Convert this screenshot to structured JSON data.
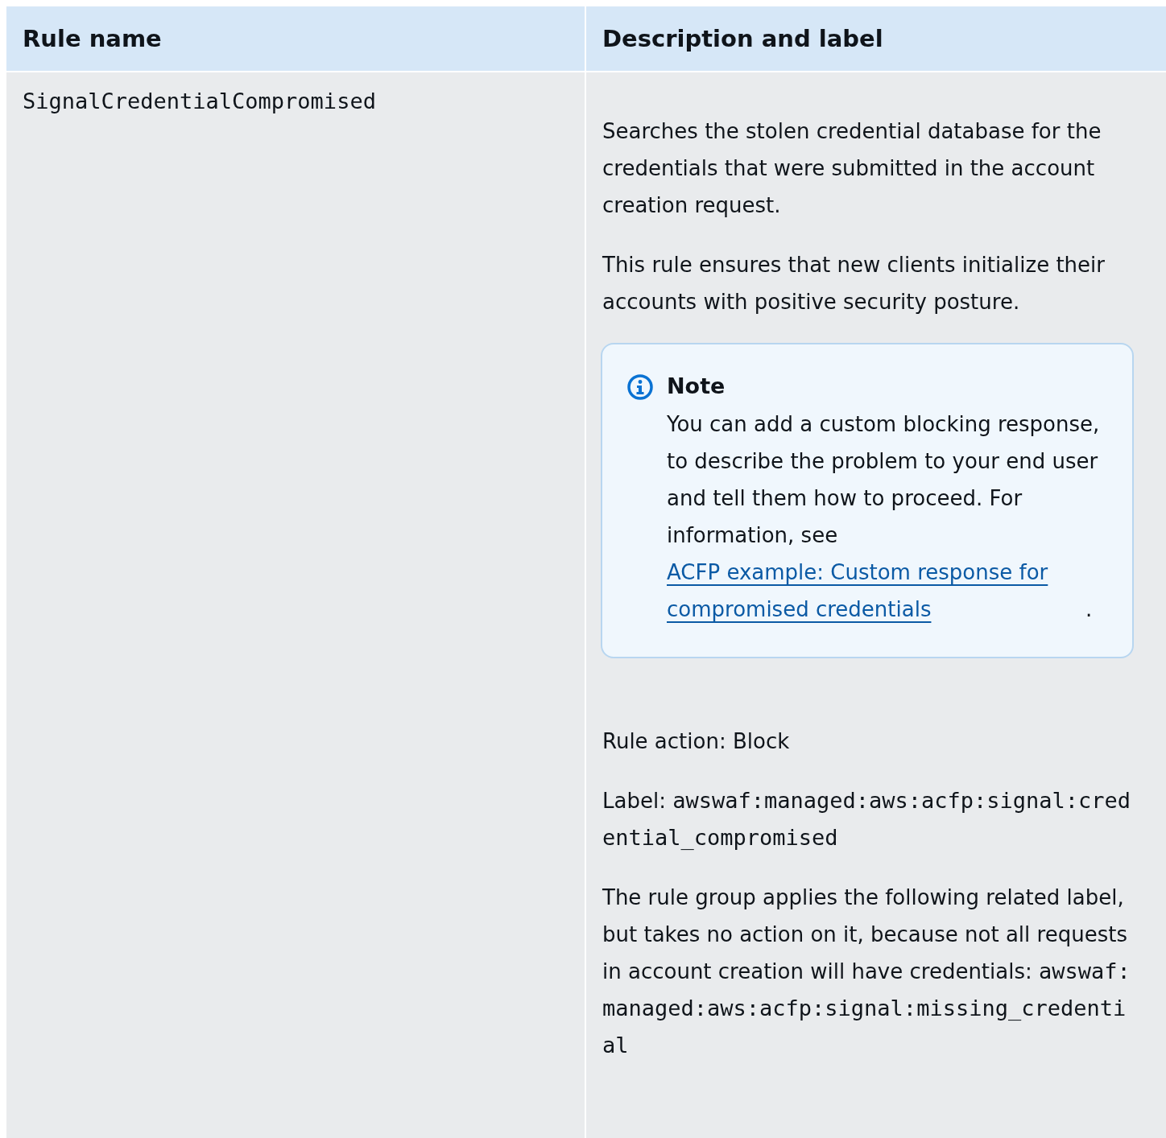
{
  "table": {
    "columns": [
      "Rule name",
      "Description and label"
    ],
    "rows": [
      {
        "rule_name": "SignalCredentialCompromised",
        "description": [
          {
            "text": "Searches the stolen credential database for the credentials that were submitted in  the account creation request."
          },
          {
            "text": "This rule ensures that new clients initialize  their accounts with positive security posture."
          }
        ],
        "note": {
          "title": "Note",
          "text": "You can add a custom blocking response, to describe the problem to your end user  and tell them how to proceed. For information, see ",
          "link": "ACFP example: Custom response for compromised credentials",
          "after": "."
        },
        "details": [
          {
            "text": "Rule action: Block"
          },
          {
            "text": "Label: ",
            "code": "awswaf:managed:aws:acfp:signal:credential_compromised"
          },
          {
            "text": "The rule group applies the following related label,   but takes no action on it, because not all requests   in account creation will have credentials:  ",
            "code": "awswaf:managed:aws:acfp:signal:missing_credential"
          }
        ]
      }
    ]
  }
}
